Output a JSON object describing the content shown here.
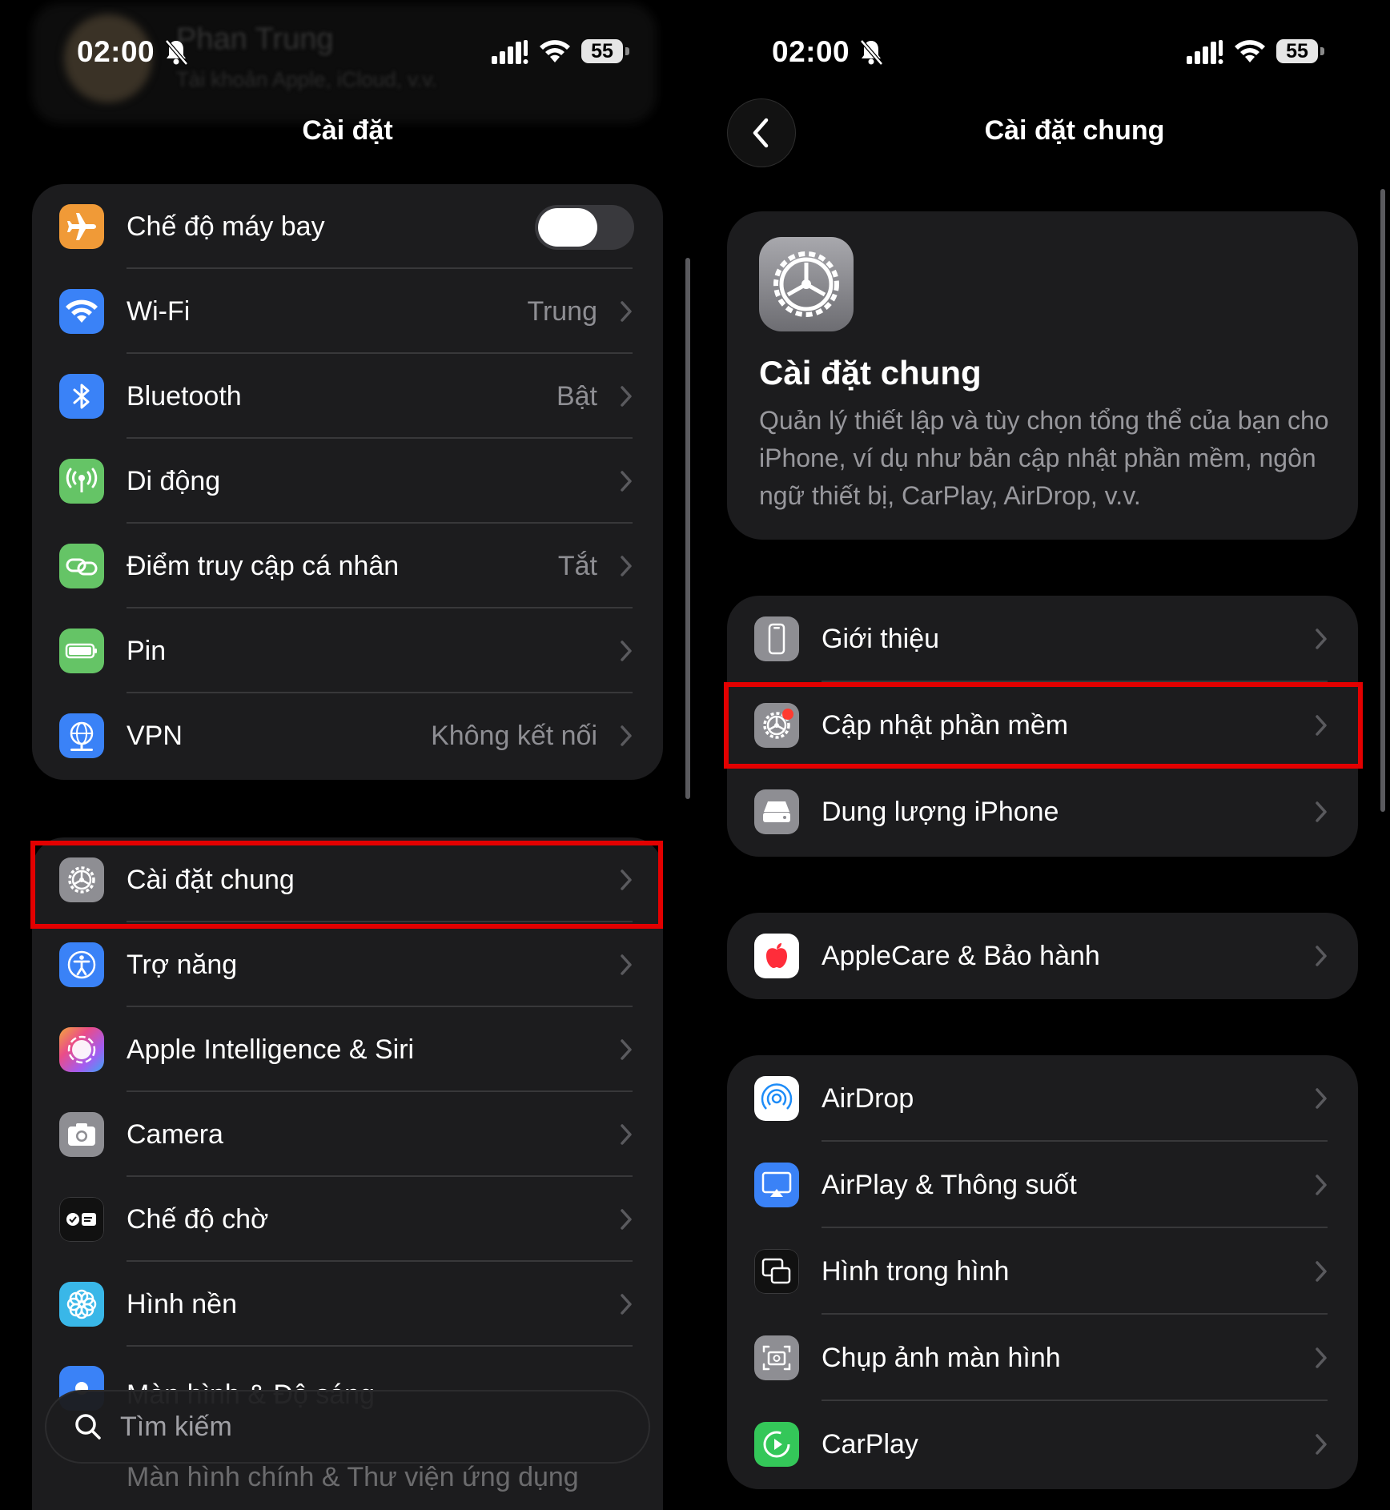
{
  "status_bar": {
    "time": "02:00",
    "battery": "55"
  },
  "left": {
    "nav_title": "Cài đặt",
    "ghost_profile": {
      "name": "Phan Trung",
      "subtitle": "Tài khoản Apple, iCloud, v.v."
    },
    "group1": [
      {
        "label": "Chế độ máy bay",
        "icon": "airplane-icon",
        "color": "#f09a37",
        "toggle": "off"
      },
      {
        "label": "Wi-Fi",
        "value": "Trung",
        "icon": "wifi-icon",
        "color": "#3a82f7"
      },
      {
        "label": "Bluetooth",
        "value": "Bật",
        "icon": "bluetooth-icon",
        "color": "#3a82f7"
      },
      {
        "label": "Di động",
        "value": "",
        "icon": "cellular-icon",
        "color": "#65c466"
      },
      {
        "label": "Điểm truy cập cá nhân",
        "value": "Tắt",
        "icon": "hotspot-icon",
        "color": "#65c466"
      },
      {
        "label": "Pin",
        "value": "",
        "icon": "battery-icon",
        "color": "#65c466"
      },
      {
        "label": "VPN",
        "value": "Không kết nối",
        "icon": "vpn-icon",
        "color": "#3a82f7"
      }
    ],
    "group2": [
      {
        "label": "Cài đặt chung",
        "icon": "gear-icon",
        "color": "#8e8e93",
        "highlighted": true
      },
      {
        "label": "Trợ năng",
        "icon": "accessibility-icon",
        "color": "#3a82f7"
      },
      {
        "label": "Apple Intelligence & Siri",
        "icon": "siri-icon",
        "color": "#e0557a"
      },
      {
        "label": "Camera",
        "icon": "camera-icon",
        "color": "#8e8e93"
      },
      {
        "label": "Chế độ chờ",
        "icon": "standby-icon",
        "color": "#1c1c1e"
      },
      {
        "label": "Hình nền",
        "icon": "wallpaper-icon",
        "color": "#39b7e8"
      }
    ],
    "partial_row": "Màn hình & Độ sáng",
    "search_placeholder": "Tìm kiếm",
    "faded_row": "Màn hình chính & Thư viện ứng dụng"
  },
  "right": {
    "nav_title": "Cài đặt chung",
    "hero": {
      "title": "Cài đặt chung",
      "description": "Quản lý thiết lập và tùy chọn tổng thể của bạn cho iPhone, ví dụ như bản cập nhật phần mềm, ngôn ngữ thiết bị, CarPlay, AirDrop, v.v."
    },
    "group1": [
      {
        "label": "Giới thiệu",
        "icon": "phone-icon",
        "color": "#8e8e93"
      },
      {
        "label": "Cập nhật phần mềm",
        "icon": "software-update-icon",
        "color": "#8e8e93",
        "highlighted": true
      },
      {
        "label": "Dung lượng iPhone",
        "icon": "storage-icon",
        "color": "#8e8e93"
      }
    ],
    "group2": [
      {
        "label": "AppleCare & Bảo hành",
        "icon": "apple-icon",
        "color": "#ffffff"
      }
    ],
    "group3": [
      {
        "label": "AirDrop",
        "icon": "airdrop-icon",
        "color": "#ffffff"
      },
      {
        "label": "AirPlay & Thông suốt",
        "icon": "airplay-icon",
        "color": "#3a82f7"
      },
      {
        "label": "Hình trong hình",
        "icon": "pip-icon",
        "color": "#1c1c1e"
      },
      {
        "label": "Chụp ảnh màn hình",
        "icon": "screenshot-icon",
        "color": "#8e8e93"
      },
      {
        "label": "CarPlay",
        "icon": "carplay-icon",
        "color": "#34c759"
      }
    ]
  }
}
